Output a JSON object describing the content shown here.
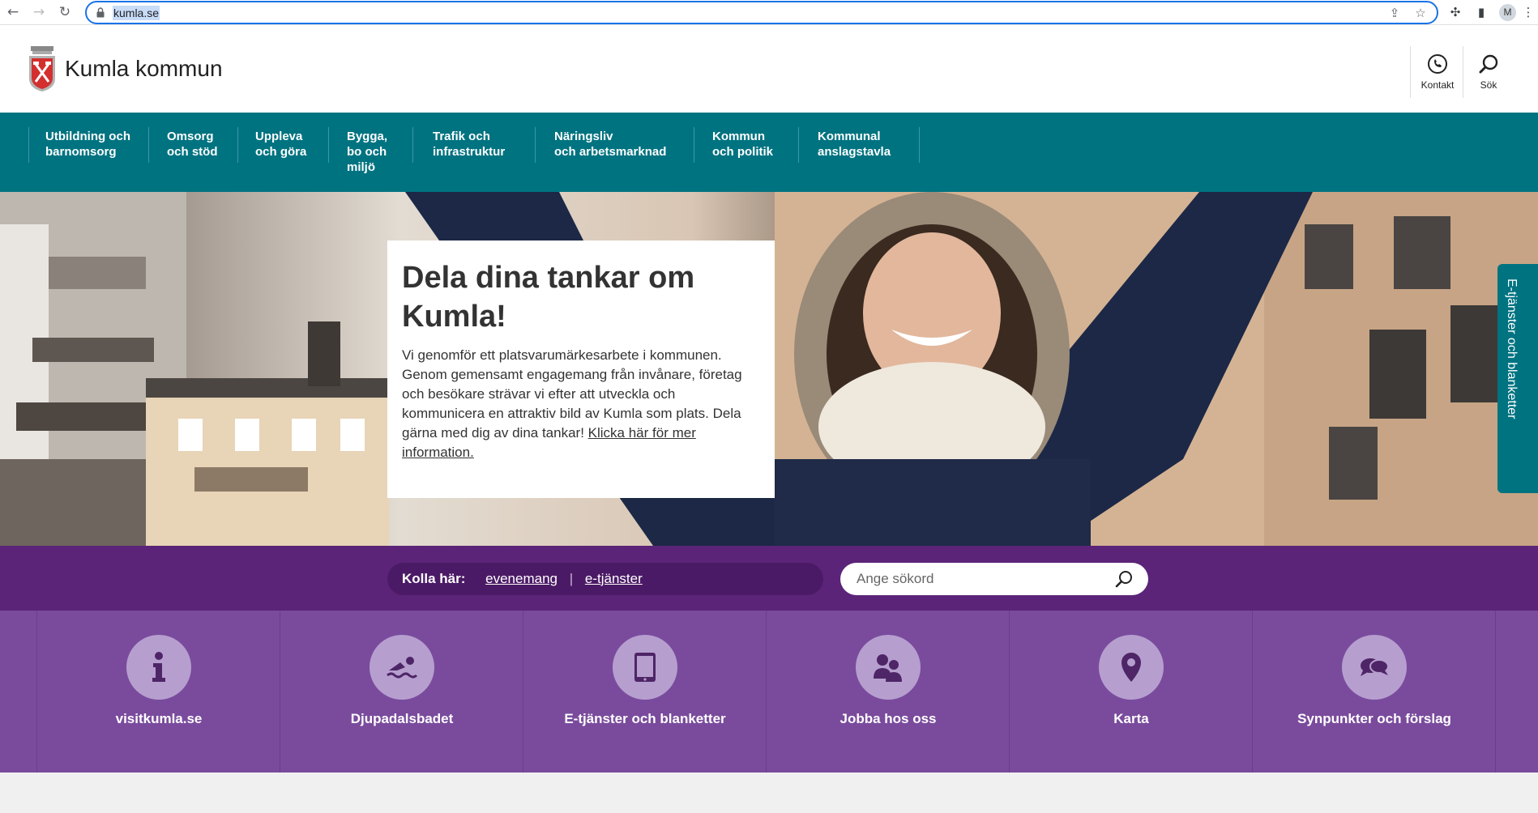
{
  "browser": {
    "url": "kumla.se",
    "avatar_letter": "M"
  },
  "site": {
    "name": "Kumla kommun",
    "tools": [
      {
        "label": "Kontakt",
        "icon": "phone-icon"
      },
      {
        "label": "Sök",
        "icon": "search-icon"
      }
    ]
  },
  "nav": {
    "items": [
      {
        "line1": "Utbildning och",
        "line2": "barnomsorg",
        "line3": ""
      },
      {
        "line1": "Omsorg",
        "line2": "och stöd",
        "line3": ""
      },
      {
        "line1": "Uppleva",
        "line2": "och göra",
        "line3": ""
      },
      {
        "line1": "Bygga,",
        "line2": "bo och",
        "line3": "miljö"
      },
      {
        "line1": "Trafik och",
        "line2": "infrastruktur",
        "line3": ""
      },
      {
        "line1": "Näringsliv",
        "line2": "och arbetsmarknad",
        "line3": ""
      },
      {
        "line1": "Kommun",
        "line2": "och politik",
        "line3": ""
      },
      {
        "line1": "Kommunal",
        "line2": "anslagstavla",
        "line3": ""
      }
    ]
  },
  "hero": {
    "title": "Dela dina tankar om Kumla!",
    "body": "Vi genomför ett platsvarumärkesarbete i kommunen. Genom gemensamt engagemang från invånare, företag och besökare strävar vi efter att utveckla och kommunicera en attraktiv bild av Kumla som plats. Dela gärna med dig av dina tankar!",
    "link": "Klicka här för mer information."
  },
  "side_tab": {
    "label": "E-tjänster och blanketter"
  },
  "band": {
    "kolla_label": "Kolla här:",
    "links": [
      "evenemang",
      "e-tjänster"
    ],
    "search_placeholder": "Ange sökord"
  },
  "quick_links": [
    {
      "label": "visitkumla.se",
      "icon": "info-icon"
    },
    {
      "label": "Djupadalsbadet",
      "icon": "swimmer-icon"
    },
    {
      "label": "E-tjänster och blanketter",
      "icon": "tablet-icon"
    },
    {
      "label": "Jobba hos oss",
      "icon": "people-icon"
    },
    {
      "label": "Karta",
      "icon": "map-pin-icon"
    },
    {
      "label": "Synpunkter och förslag",
      "icon": "speech-bubbles-icon"
    }
  ],
  "colors": {
    "teal": "#007381",
    "purple_dark": "#5b2478",
    "purple": "#7a4b9d",
    "circle": "#b69fcf"
  }
}
